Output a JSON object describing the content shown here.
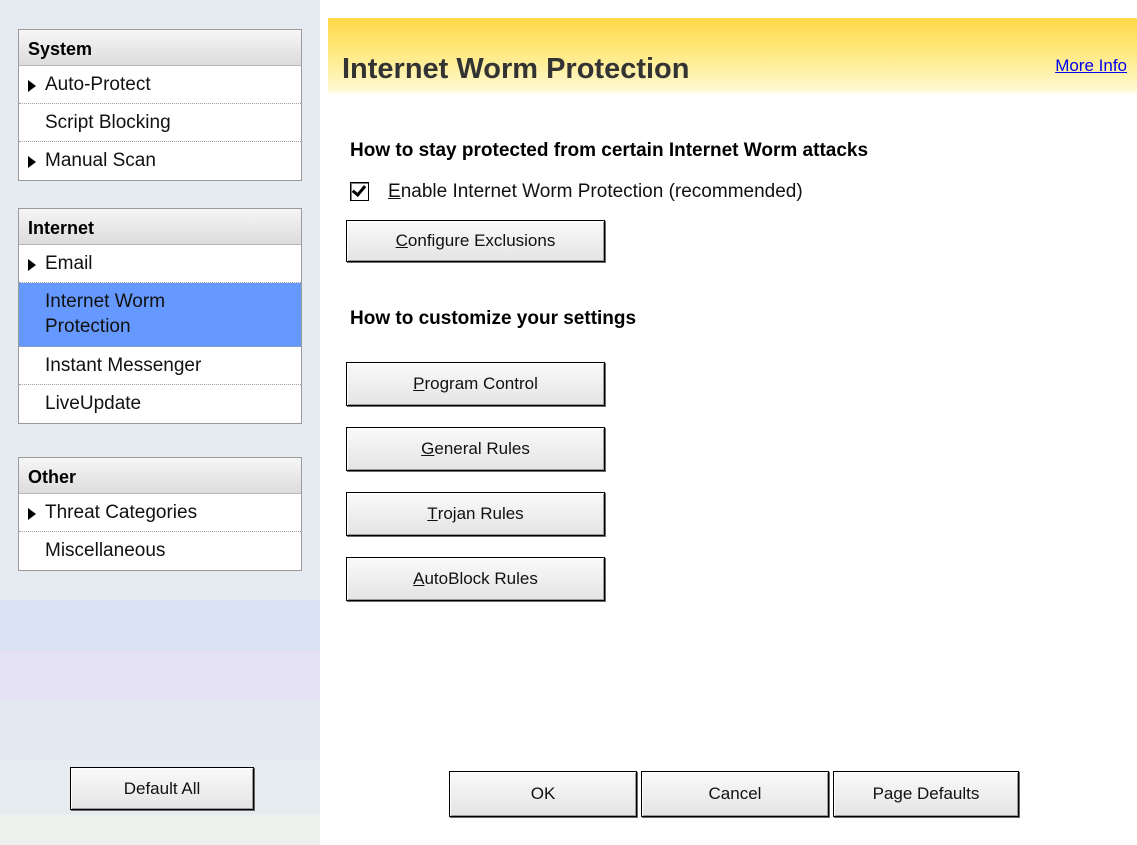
{
  "sidebar": {
    "groups": [
      {
        "title": "System",
        "items": [
          {
            "label": "Auto-Protect",
            "arrow": true
          },
          {
            "label": "Script Blocking",
            "arrow": false
          },
          {
            "label": "Manual Scan",
            "arrow": true
          }
        ]
      },
      {
        "title": "Internet",
        "items": [
          {
            "label": "Email",
            "arrow": true
          },
          {
            "label": "Internet Worm Protection",
            "arrow": false,
            "selected": true
          },
          {
            "label": "Instant Messenger",
            "arrow": false
          },
          {
            "label": "LiveUpdate",
            "arrow": false
          }
        ]
      },
      {
        "title": "Other",
        "items": [
          {
            "label": "Threat Categories",
            "arrow": true
          },
          {
            "label": "Miscellaneous",
            "arrow": false
          }
        ]
      }
    ],
    "default_all_label": "Default All"
  },
  "header": {
    "title": "Internet Worm Protection",
    "more_info": "More Info"
  },
  "section_protect": {
    "heading": "How to stay protected from certain Internet Worm attacks",
    "checkbox": {
      "mnemonic": "E",
      "label_rest": "nable Internet Worm Protection (recommended)",
      "checked": true
    },
    "configure_btn": {
      "mnemonic": "C",
      "rest": "onfigure Exclusions"
    }
  },
  "section_customize": {
    "heading": "How to customize your settings",
    "buttons": {
      "program_control": {
        "mnemonic": "P",
        "rest": "rogram Control"
      },
      "general_rules": {
        "mnemonic": "G",
        "rest": "eneral Rules"
      },
      "trojan_rules": {
        "mnemonic": "T",
        "rest": "rojan Rules"
      },
      "autoblock_rules": {
        "mnemonic": "A",
        "rest": "utoBlock Rules"
      }
    }
  },
  "footer": {
    "ok": "OK",
    "cancel": "Cancel",
    "page_defaults": "Page Defaults"
  },
  "colors": {
    "selected_item": "#6699ff",
    "link": "#0000ee",
    "header_yellow": "#ffd84a"
  }
}
